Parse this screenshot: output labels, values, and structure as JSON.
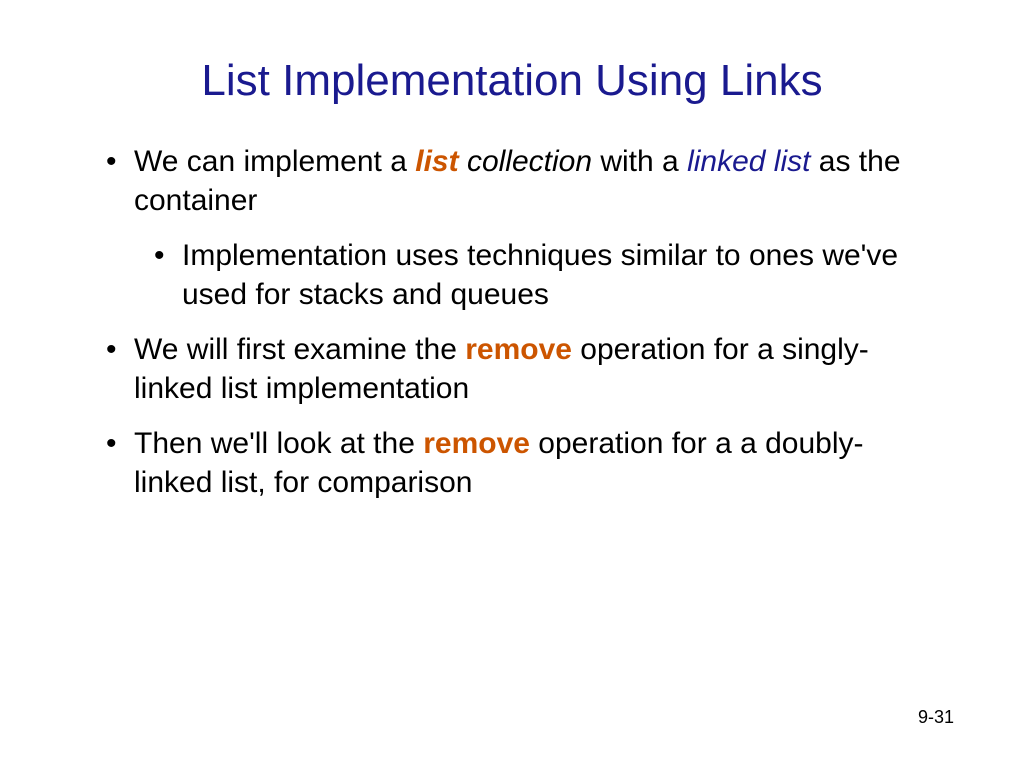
{
  "title": "List Implementation Using Links",
  "bullets": {
    "b1": {
      "t1": "We can implement a ",
      "t2": "list",
      "t3": " collection",
      "t4": " with a ",
      "t5": "linked list",
      "t6": " as the container"
    },
    "b1sub": {
      "t1": "Implementation uses techniques similar to ones we've used for stacks and queues"
    },
    "b2": {
      "t1": "We will first examine the ",
      "t2": "remove",
      "t3": " operation for a singly-linked list implementation"
    },
    "b3": {
      "t1": "Then we'll look at the ",
      "t2": "remove",
      "t3": " operation for a a doubly-linked list, for comparison"
    }
  },
  "pageNumber": "9-31"
}
